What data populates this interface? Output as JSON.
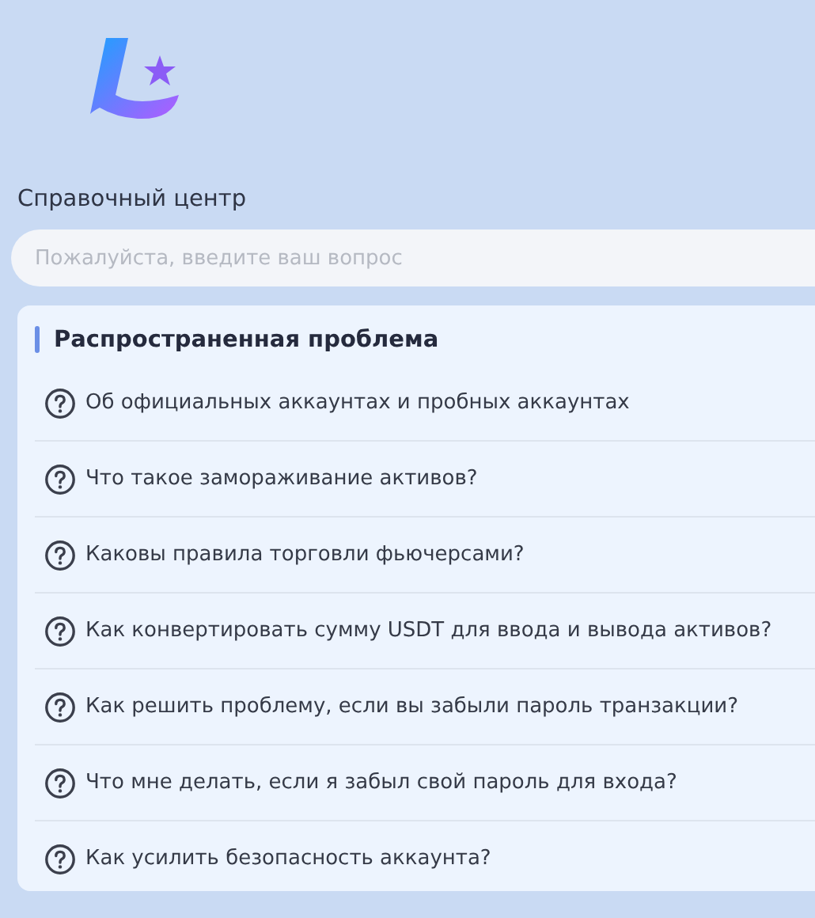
{
  "header": {
    "title": "Справочный центр"
  },
  "search": {
    "placeholder": "Пожалуйста, введите ваш вопрос"
  },
  "faq": {
    "heading": "Распространенная проблема",
    "items": [
      "Об официальных аккаунтах и пробных аккаунтах",
      "Что такое замораживание активов?",
      "Каковы правила торговли фьючерсами?",
      "Как конвертировать сумму USDT для ввода и вывода активов?",
      "Как решить проблему, если вы забыли пароль транзакции?",
      "Что мне делать, если я забыл свой пароль для входа?",
      "Как усилить безопасность аккаунта?"
    ]
  }
}
